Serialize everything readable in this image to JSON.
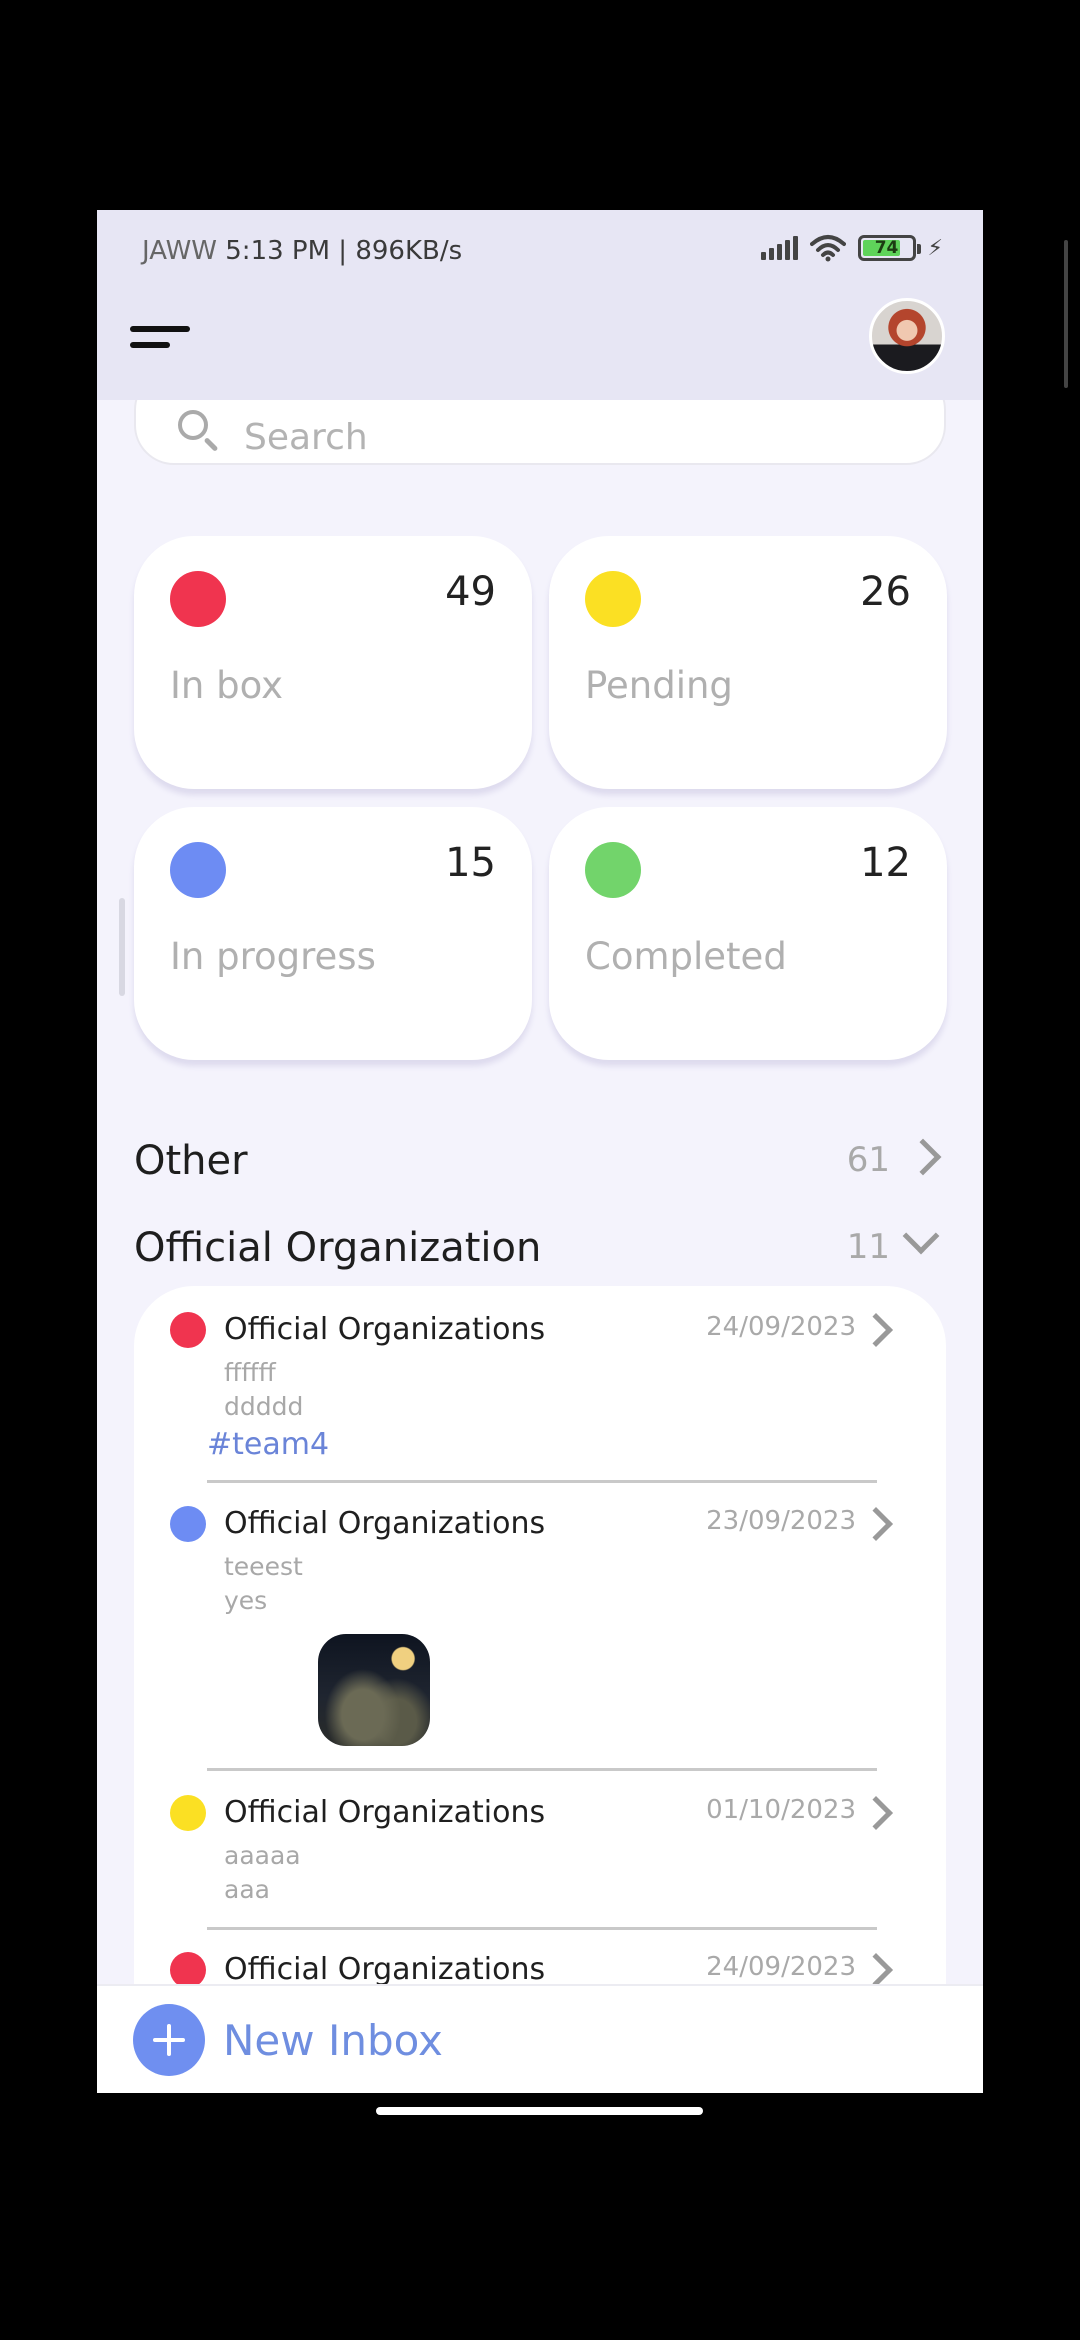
{
  "status_bar": {
    "carrier": "JAWW",
    "time_speed": "5:13 PM | 896KB/s",
    "battery": "74",
    "icons": [
      "signal-icon",
      "wifi-icon",
      "battery-icon",
      "charging-bolt-icon"
    ]
  },
  "header": {
    "icons": [
      "menu-icon",
      "avatar"
    ]
  },
  "search": {
    "placeholder": "Search",
    "icon": "search-icon"
  },
  "stats": [
    {
      "label": "In box",
      "count": "49",
      "color": "#f0344f"
    },
    {
      "label": "Pending",
      "count": "26",
      "color": "#fbe023"
    },
    {
      "label": "In progress",
      "count": "15",
      "color": "#6d8cf3"
    },
    {
      "label": "Completed",
      "count": "12",
      "color": "#72d46b"
    }
  ],
  "sections": {
    "other": {
      "title": "Other",
      "count": "61",
      "icon": "chevron-right-icon"
    },
    "official": {
      "title": "Official Organization",
      "count": "11",
      "icon": "chevron-down-icon"
    }
  },
  "items": [
    {
      "title": "Official Organizations",
      "date": "24/09/2023",
      "line1": "ffffff",
      "line2": "ddddd",
      "tag": "#team4",
      "color": "#f0344f"
    },
    {
      "title": "Official Organizations",
      "date": "23/09/2023",
      "line1": "teeest",
      "line2": "yes",
      "color": "#6d8cf3",
      "image": "night-moon-clouds-thumbnail"
    },
    {
      "title": "Official Organizations",
      "date": "01/10/2023",
      "line1": "aaaaa",
      "line2": "aaa",
      "color": "#fbe023"
    },
    {
      "title": "Official Organizations",
      "date": "24/09/2023",
      "color": "#f0344f"
    }
  ],
  "bottom": {
    "label": "New Inbox",
    "icon": "plus-icon"
  }
}
